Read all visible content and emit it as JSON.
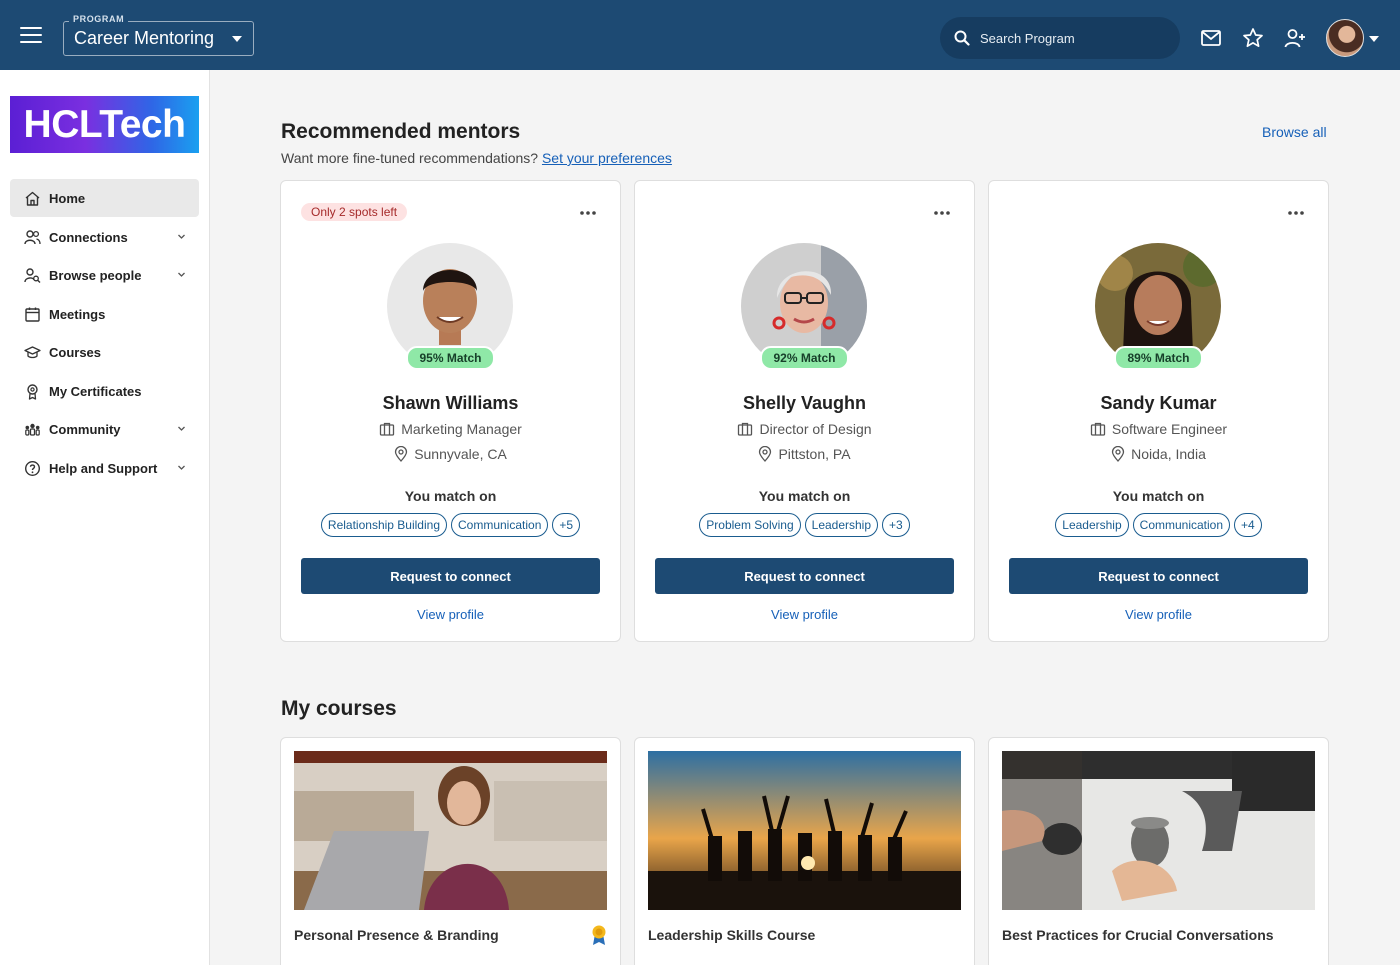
{
  "topbar": {
    "program_caption": "PROGRAM",
    "program_name": "Career Mentoring",
    "search_placeholder": "Search Program",
    "icons": [
      "menu-icon",
      "search-icon",
      "mail-icon",
      "star-icon",
      "add-user-icon",
      "avatar",
      "chevron-down-icon"
    ]
  },
  "sidebar": {
    "logo_text": "HCLTech",
    "items": [
      {
        "label": "Home",
        "icon": "home-icon",
        "active": true,
        "expandable": false
      },
      {
        "label": "Connections",
        "icon": "connections-icon",
        "active": false,
        "expandable": true
      },
      {
        "label": "Browse people",
        "icon": "browse-people-icon",
        "active": false,
        "expandable": true
      },
      {
        "label": "Meetings",
        "icon": "calendar-icon",
        "active": false,
        "expandable": false
      },
      {
        "label": "Courses",
        "icon": "graduation-cap-icon",
        "active": false,
        "expandable": false
      },
      {
        "label": "My Certificates",
        "icon": "certificate-icon",
        "active": false,
        "expandable": false
      },
      {
        "label": "Community",
        "icon": "community-icon",
        "active": false,
        "expandable": true
      },
      {
        "label": "Help and Support",
        "icon": "help-icon",
        "active": false,
        "expandable": true
      }
    ]
  },
  "mentors_section": {
    "title": "Recommended mentors",
    "subtitle": "Want more fine-tuned recommendations?",
    "preferences_link": "Set your preferences",
    "browse_all": "Browse all",
    "match_on_label": "You match on",
    "connect_label": "Request to connect",
    "view_profile_label": "View profile",
    "mentors": [
      {
        "spots": "Only 2 spots left",
        "match": "95% Match",
        "name": "Shawn Williams",
        "title": "Marketing Manager",
        "location": "Sunnyvale, CA",
        "tags": [
          "Relationship Building",
          "Communication",
          "+5"
        ]
      },
      {
        "spots": "",
        "match": "92% Match",
        "name": "Shelly Vaughn",
        "title": "Director of Design",
        "location": "Pittston, PA",
        "tags": [
          "Problem Solving",
          "Leadership",
          "+3"
        ]
      },
      {
        "spots": "",
        "match": "89% Match",
        "name": "Sandy Kumar",
        "title": "Software Engineer",
        "location": "Noida, India",
        "tags": [
          "Leadership",
          "Communication",
          "+4"
        ]
      }
    ]
  },
  "courses_section": {
    "title": "My courses",
    "courses": [
      {
        "title": "Personal Presence & Branding",
        "badge": true
      },
      {
        "title": "Leadership Skills Course",
        "badge": false
      },
      {
        "title": "Best Practices for Crucial Conversations",
        "badge": false
      }
    ]
  },
  "colors": {
    "primary": "#1d4a73",
    "link": "#1660b8",
    "match_badge": "#8fe8a7",
    "spots_badge": "#fde2e2"
  }
}
